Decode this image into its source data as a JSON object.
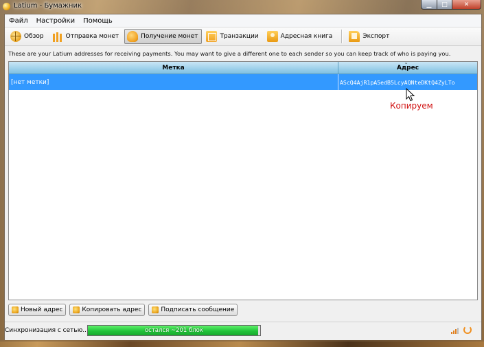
{
  "window": {
    "title": "Latium - Бумажник"
  },
  "menu": [
    "Файл",
    "Настройки",
    "Помощь"
  ],
  "toolbar": {
    "overview": "Обзор",
    "send": "Отправка монет",
    "receive": "Получение монет",
    "transactions": "Транзакции",
    "address_book": "Адресная книга",
    "export": "Экспорт"
  },
  "info_text": "These are your Latium addresses for receiving payments. You may want to give a different one to each sender so you can keep track of who is paying you.",
  "table": {
    "headers": {
      "label": "Метка",
      "address": "Адрес"
    },
    "rows": [
      {
        "label": "[нет метки]",
        "address": "AScQ4AjR1pA5edB5LcyAQNteDKtQ4ZyLTo"
      }
    ]
  },
  "annotation": "Копируем",
  "buttons": {
    "new_address": "Новый адрес",
    "copy_address": "Копировать адрес",
    "sign_message": "Подписать сообщение"
  },
  "status": {
    "sync_label": "Синхронизация с сетью...",
    "progress_text": "остался ~201 блок",
    "progress_fraction": 0.99
  },
  "colors": {
    "selection": "#3399ff",
    "header": "#9fd2ee",
    "progress": "#22c43a",
    "annotation": "#d01010"
  }
}
